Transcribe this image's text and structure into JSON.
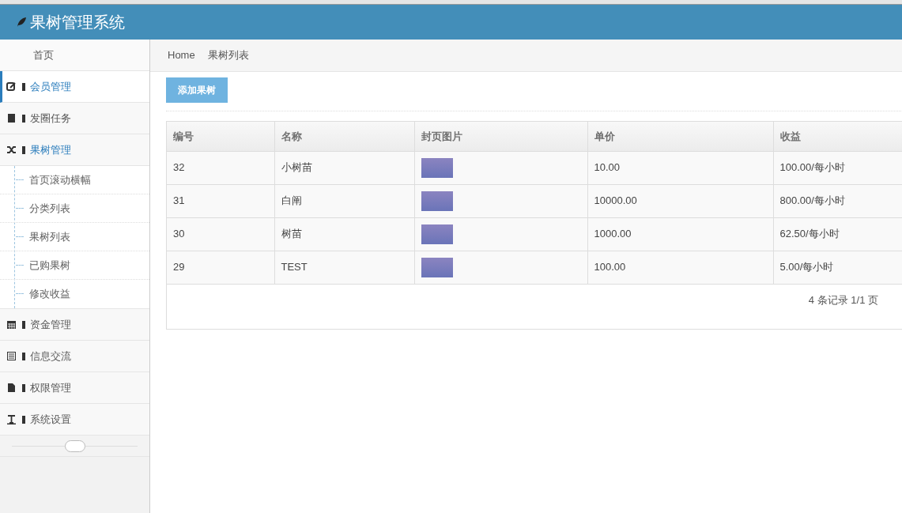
{
  "header": {
    "title": "果树管理系统"
  },
  "sidebar": {
    "home": "首页",
    "items": [
      {
        "kind": "menu",
        "label": "会员管理",
        "selected": true,
        "expanded": false
      },
      {
        "kind": "menu",
        "label": "发圈任务",
        "selected": false,
        "expanded": false
      },
      {
        "kind": "menu",
        "label": "果树管理",
        "selected": false,
        "expanded": true,
        "children": [
          {
            "label": "首页滚动横幅"
          },
          {
            "label": "分类列表"
          },
          {
            "label": "果树列表"
          },
          {
            "label": "已购果树"
          },
          {
            "label": "修改收益"
          }
        ]
      },
      {
        "kind": "menu",
        "label": "资金管理",
        "selected": false,
        "expanded": false
      },
      {
        "kind": "menu",
        "label": "信息交流",
        "selected": false,
        "expanded": false
      },
      {
        "kind": "menu",
        "label": "权限管理",
        "selected": false,
        "expanded": false
      },
      {
        "kind": "menu",
        "label": "系统设置",
        "selected": false,
        "expanded": false
      }
    ]
  },
  "breadcrumb": [
    "Home",
    "果树列表"
  ],
  "add_button": "添加果树",
  "table": {
    "columns": [
      "编号",
      "名称",
      "封页图片",
      "单价",
      "收益"
    ],
    "rows": [
      {
        "id": "32",
        "name": "小树苗",
        "price": "10.00",
        "income": "100.00/每小时"
      },
      {
        "id": "31",
        "name": "白阐",
        "price": "10000.00",
        "income": "800.00/每小时"
      },
      {
        "id": "30",
        "name": "树苗",
        "price": "1000.00",
        "income": "62.50/每小时"
      },
      {
        "id": "29",
        "name": "TEST",
        "price": "100.00",
        "income": "5.00/每小时"
      }
    ]
  },
  "pagination": "4 条记录 1/1 页"
}
